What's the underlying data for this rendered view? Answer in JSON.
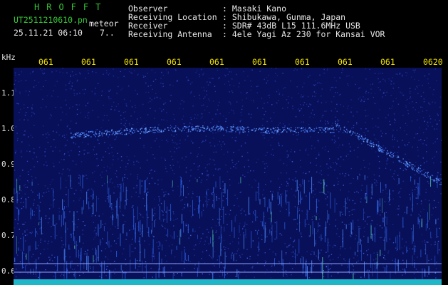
{
  "header": {
    "app_title": "HROFFT",
    "filename": "UT2511210610.pn",
    "filename_suffix": "meteor",
    "datetime": "25.11.21 06:10",
    "extra": "7..",
    "labels": [
      "Observer",
      "Receiving Location",
      "Receiver",
      "Receiving Antenna"
    ],
    "values": [
      ": Masaki Kano",
      ": Shibukawa, Gunma, Japan",
      ": SDR# 43dB L15 111.6MHz USB",
      ": 4ele Yagi Az 230 for Kansai VOR"
    ]
  },
  "axis": {
    "y_unit": "kHz",
    "y_ticks": [
      "1.1",
      "1.0",
      "0.9",
      "0.8",
      "0.7",
      "0.6"
    ],
    "x_ticks": [
      "061",
      "061",
      "061",
      "061",
      "061",
      "061",
      "061",
      "061",
      "061",
      "0620"
    ]
  },
  "colors": {
    "background": "#000000",
    "header_green": "#35c935",
    "header_white": "#e8e8e8",
    "tick_yellow": "#f0e000",
    "spectrum_base": "#08105a",
    "signal": "#4d8cff"
  }
}
